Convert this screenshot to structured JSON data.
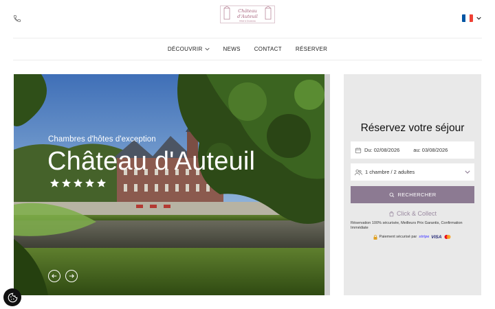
{
  "header": {
    "phone_icon": "phone-icon",
    "logo_line1": "Château",
    "logo_line2": "d'Auteuil",
    "logo_tagline": "Hôtel & Chambres",
    "language_flag": "flag-france",
    "flag_colors": [
      "#0055a4",
      "#ffffff",
      "#ef4135"
    ]
  },
  "nav": {
    "items": [
      {
        "label": "DÉCOUVRIR",
        "has_dropdown": true
      },
      {
        "label": "NEWS"
      },
      {
        "label": "CONTACT"
      },
      {
        "label": "RÉSERVER"
      }
    ]
  },
  "hero": {
    "subtitle": "Chambres d'hôtes d'exception",
    "title": "Château d'Auteuil",
    "rating": 5
  },
  "booking": {
    "title": "Réservez votre séjour",
    "date_from": "Du: 02/08/2026",
    "date_to": "au: 03/08/2026",
    "rooms_guests": "1 chambre / 2 adultes",
    "search_label": "RECHERCHER",
    "click_collect": "Click & Collect",
    "guarantee": "Réservation 100% sécurisée, Meilleurs Prix Garantis, Confirmation Immédiate",
    "payment_label": "Paiement sécurisé par",
    "payment_stripe": "stripe",
    "payment_visa": "VISA",
    "accent_color": "#8c7a92",
    "panel_bg": "#e9e9e9"
  },
  "cookie": {
    "icon": "cookie-icon"
  }
}
